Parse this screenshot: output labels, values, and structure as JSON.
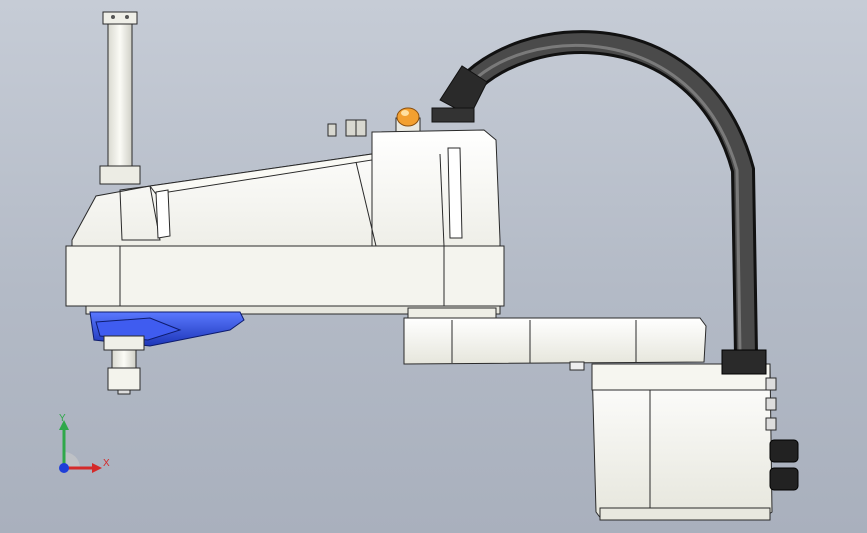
{
  "viewport": {
    "background_top": "#c6ccd6",
    "background_bottom": "#a9b0bd"
  },
  "model": {
    "body_color": "#f2f2ea",
    "edge_color": "#2a2a2a",
    "joint_color": "#2f4fd6",
    "cable_color": "#2c2c2c",
    "lamp_color": "#f3a030"
  },
  "triad": {
    "y_label": "Y",
    "x_label": "X",
    "y_color": "#2fa84a",
    "x_color": "#d42a2a",
    "z_color": "#1f3fd8"
  }
}
